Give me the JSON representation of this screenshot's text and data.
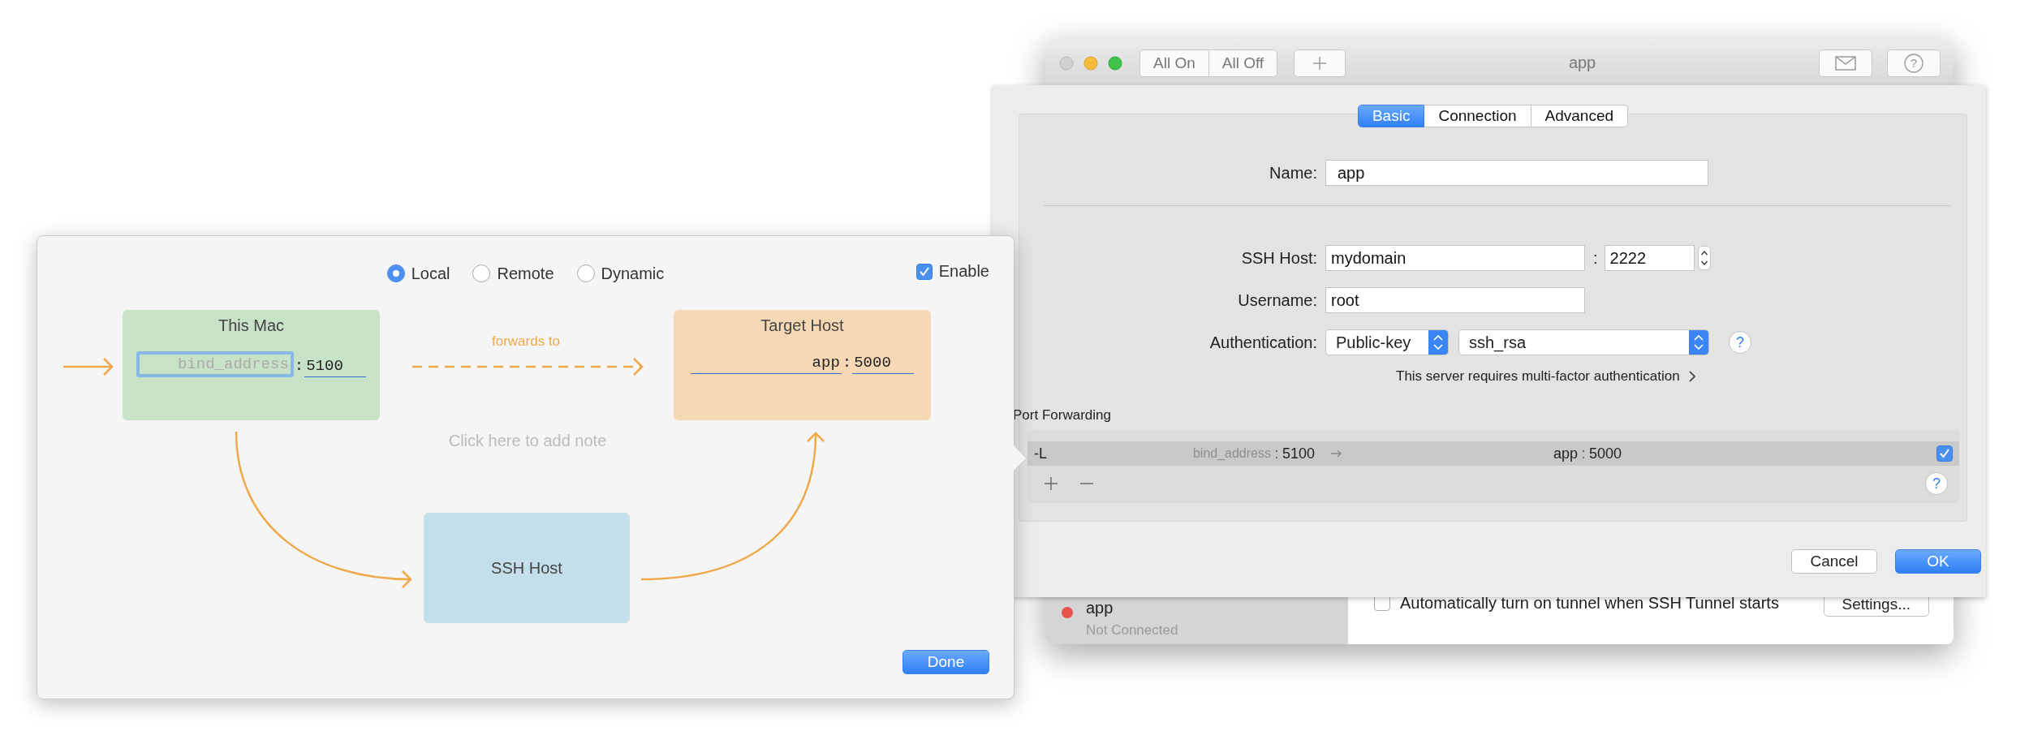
{
  "window": {
    "title": "app",
    "toolbar": [
      "All On",
      "All Off"
    ],
    "help_glyph": "?",
    "tunnels": [
      {
        "name": "app",
        "status": "Not Connected",
        "color": "#e5534b"
      }
    ],
    "auto_start": {
      "label": "Automatically turn on tunnel when SSH Tunnel starts",
      "checked": false
    },
    "settings_button": "Settings..."
  },
  "sheet": {
    "tabs": [
      {
        "label": "Basic",
        "selected": true
      },
      {
        "label": "Connection",
        "selected": false
      },
      {
        "label": "Advanced",
        "selected": false
      }
    ],
    "name": {
      "label": "Name:",
      "value": "app"
    },
    "ssh_host": {
      "label": "SSH Host:",
      "value": "mydomain",
      "separator": ":",
      "port": "2222"
    },
    "username": {
      "label": "Username:",
      "value": "root"
    },
    "authentication": {
      "label": "Authentication:",
      "method": "Public-key",
      "key": "ssh_rsa",
      "help_glyph": "?"
    },
    "mfa_link": "This server requires multi-factor authentication",
    "port_forwarding": {
      "title": "Port Forwarding",
      "rows": [
        {
          "flag": "-L",
          "bind_placeholder": "bind_address",
          "separator": ":",
          "port": "5100",
          "host": "app",
          "host_separator": ":",
          "host_port": "5000",
          "selected": true,
          "enabled": true
        }
      ],
      "help_glyph": "?"
    },
    "buttons": [
      "Cancel",
      "OK"
    ]
  },
  "popover": {
    "modes": [
      {
        "label": "Local",
        "selected": true
      },
      {
        "label": "Remote",
        "selected": false
      },
      {
        "label": "Dynamic",
        "selected": false
      }
    ],
    "enable": {
      "label": "Enable",
      "checked": true
    },
    "this_mac": {
      "title": "This Mac",
      "bind_placeholder": "bind_address",
      "separator": ":",
      "port": "5100"
    },
    "link_label": "forwards to",
    "target_host": {
      "title": "Target Host",
      "host": "app",
      "separator": ":",
      "port": "5000"
    },
    "note_placeholder": "Click here to add note",
    "ssh_host": {
      "title": "SSH Host"
    },
    "done_button": "Done"
  }
}
